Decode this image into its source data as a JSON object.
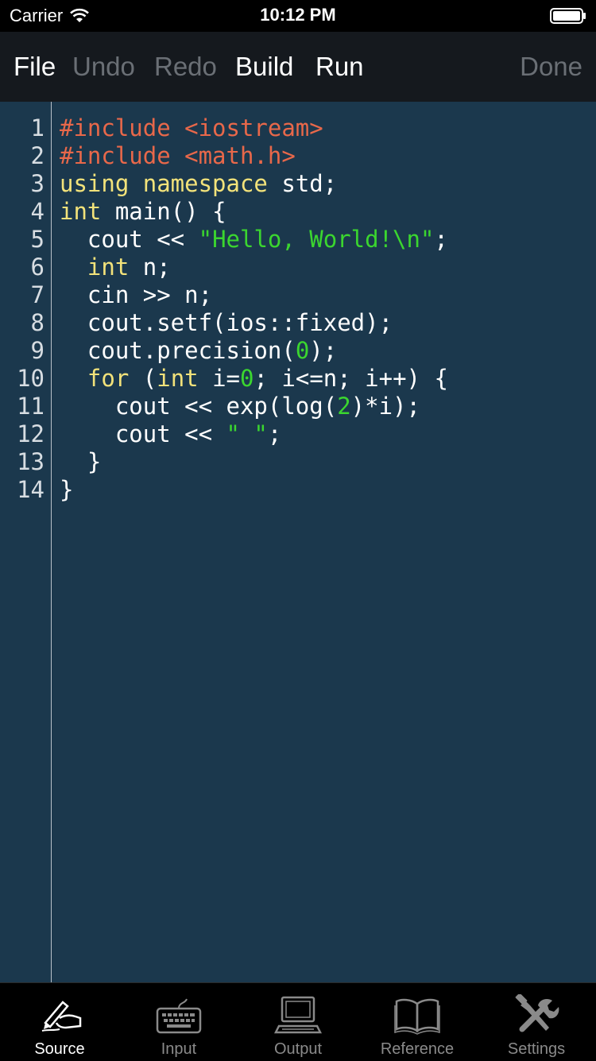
{
  "status": {
    "carrier": "Carrier",
    "time": "10:12 PM"
  },
  "toolbar": {
    "file": "File",
    "undo": "Undo",
    "redo": "Redo",
    "build": "Build",
    "run": "Run",
    "done": "Done"
  },
  "editor": {
    "line_numbers": [
      "1",
      "2",
      "3",
      "4",
      "5",
      "6",
      "7",
      "8",
      "9",
      "10",
      "11",
      "12",
      "13",
      "14"
    ],
    "lines": [
      [
        {
          "t": "pre",
          "v": "#include <iostream>"
        }
      ],
      [
        {
          "t": "pre",
          "v": "#include <math.h>"
        }
      ],
      [
        {
          "t": "kw",
          "v": "using namespace"
        },
        {
          "t": "plain",
          "v": " std;"
        }
      ],
      [
        {
          "t": "kw",
          "v": "int"
        },
        {
          "t": "plain",
          "v": " main() {"
        }
      ],
      [
        {
          "t": "plain",
          "v": "  cout << "
        },
        {
          "t": "str",
          "v": "\"Hello, World!\\n\""
        },
        {
          "t": "plain",
          "v": ";"
        }
      ],
      [
        {
          "t": "plain",
          "v": "  "
        },
        {
          "t": "kw",
          "v": "int"
        },
        {
          "t": "plain",
          "v": " n;"
        }
      ],
      [
        {
          "t": "plain",
          "v": "  cin >> n;"
        }
      ],
      [
        {
          "t": "plain",
          "v": "  cout.setf(ios::fixed);"
        }
      ],
      [
        {
          "t": "plain",
          "v": "  cout.precision("
        },
        {
          "t": "num",
          "v": "0"
        },
        {
          "t": "plain",
          "v": ");"
        }
      ],
      [
        {
          "t": "plain",
          "v": "  "
        },
        {
          "t": "kw",
          "v": "for"
        },
        {
          "t": "plain",
          "v": " ("
        },
        {
          "t": "kw",
          "v": "int"
        },
        {
          "t": "plain",
          "v": " i="
        },
        {
          "t": "num",
          "v": "0"
        },
        {
          "t": "plain",
          "v": "; i<=n; i++) {"
        }
      ],
      [
        {
          "t": "plain",
          "v": "    cout << exp(log("
        },
        {
          "t": "num",
          "v": "2"
        },
        {
          "t": "plain",
          "v": ")*i);"
        }
      ],
      [
        {
          "t": "plain",
          "v": "    cout << "
        },
        {
          "t": "str",
          "v": "\" \""
        },
        {
          "t": "plain",
          "v": ";"
        }
      ],
      [
        {
          "t": "plain",
          "v": "  }"
        }
      ],
      [
        {
          "t": "plain",
          "v": "}"
        }
      ]
    ]
  },
  "tabs": [
    {
      "label": "Source",
      "icon": "pen-hand-icon",
      "active": true
    },
    {
      "label": "Input",
      "icon": "keyboard-icon",
      "active": false
    },
    {
      "label": "Output",
      "icon": "computer-icon",
      "active": false
    },
    {
      "label": "Reference",
      "icon": "book-icon",
      "active": false
    },
    {
      "label": "Settings",
      "icon": "tools-icon",
      "active": false
    }
  ]
}
